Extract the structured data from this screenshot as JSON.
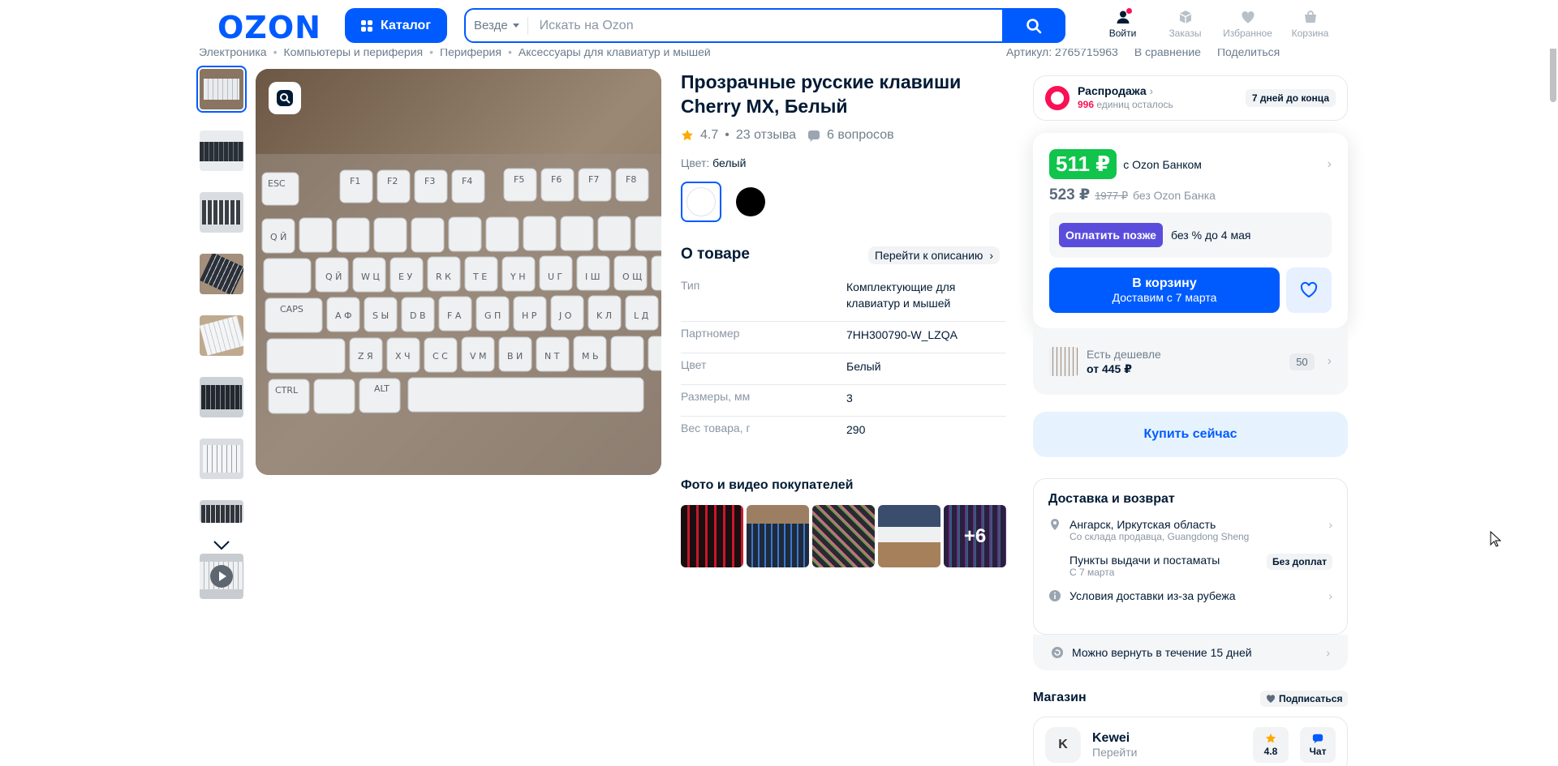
{
  "header": {
    "logo": "OZON",
    "catalog_label": "Каталог",
    "search_scope": "Везде",
    "search_placeholder": "Искать на Ozon",
    "icons": [
      {
        "label": "Войти",
        "icon": "user-icon"
      },
      {
        "label": "Заказы",
        "icon": "box-icon"
      },
      {
        "label": "Избранное",
        "icon": "heart-icon"
      },
      {
        "label": "Корзина",
        "icon": "cart-icon"
      }
    ]
  },
  "breadcrumb": [
    "Электроника",
    "Компьютеры и периферия",
    "Периферия",
    "Аксессуары для клавиатур и мышей"
  ],
  "meta": {
    "article": "Артикул: 2765715963",
    "compare": "В сравнение",
    "share": "Поделиться"
  },
  "product": {
    "title": "Прозрачные русские клавиши Cherry MX, Белый",
    "rating": "4.7",
    "reviews": "23 отзыва",
    "questions": "6 вопросов",
    "color_label": "Цвет:",
    "color_value": "белый"
  },
  "about": {
    "title": "О товаре",
    "to_description": "Перейти к описанию",
    "specs": [
      {
        "k": "Тип",
        "v": "Комплектующие для клавиатур и мышей"
      },
      {
        "k": "Партномер",
        "v": "7HH300790-W_LZQA"
      },
      {
        "k": "Цвет",
        "v": "Белый"
      },
      {
        "k": "Размеры, мм",
        "v": "3"
      },
      {
        "k": "Вес товара, г",
        "v": "290"
      }
    ]
  },
  "buyer_photos": {
    "title": "Фото и видео покупателей",
    "more": "+6"
  },
  "sale": {
    "title": "Распродажа",
    "count": "996",
    "remaining": "единиц осталось",
    "days": "7 дней до конца"
  },
  "price": {
    "bank_price": "511 ₽",
    "with_bank": "с Ozon Банком",
    "price": "523 ₽",
    "old_price": "1977 ₽",
    "without_bank": "без Ozon Банка",
    "paylater_btn": "Оплатить позже",
    "paylater_text": "без % до 4 мая",
    "cart_btn": "В корзину",
    "cart_sub": "Доставим с 7 марта"
  },
  "cheaper": {
    "label": "Есть дешевле",
    "price": "от 445 ₽",
    "count": "50"
  },
  "buy_now": "Купить сейчас",
  "delivery": {
    "title": "Доставка и возврат",
    "city": "Ангарск, Иркутская область",
    "warehouse": "Со склада продавца, Guangdong Sheng",
    "pickup": "Пункты выдачи и постаматы",
    "pickup_date": "С 7 марта",
    "pickup_badge": "Без доплат",
    "abroad": "Условия доставки из-за рубежа",
    "return": "Можно вернуть в течение 15 дней"
  },
  "shop": {
    "title": "Магазин",
    "subscribe": "Подписаться",
    "avatar": "K",
    "name": "Kewei",
    "go": "Перейти",
    "rating": "4.8",
    "chat": "Чат"
  },
  "colors": {
    "brand": "#005bff",
    "green": "#10c44c",
    "pink": "#f91155",
    "violet": "#5b4ddb"
  }
}
